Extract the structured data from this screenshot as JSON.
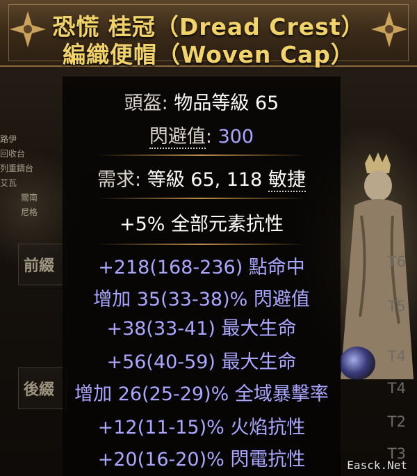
{
  "item": {
    "name": "恐慌 桂冠（Dread Crest）",
    "base_type": "編織便帽（Woven Cap）",
    "category": "頭盔",
    "item_level_label": "物品等級",
    "item_level": "65",
    "evasion_label": "閃避值",
    "evasion_value": "300",
    "requirement_label": "需求",
    "requirement_level_text": "等級 65, 118",
    "requirement_dex": "敏捷",
    "implicit": "+5% 全部元素抗性"
  },
  "mods": [
    {
      "text": "+218(168-236) 點命中",
      "tier": "T6"
    },
    {
      "text": "增加 35(33-38)% 閃避值",
      "tier": "T5"
    },
    {
      "text": "+38(33-41) 最大生命",
      "tier": ""
    },
    {
      "text": "+56(40-59) 最大生命",
      "tier": "T4"
    },
    {
      "text": "增加 26(25-29)% 全域暴擊率",
      "tier": "T4"
    },
    {
      "text": "+12(11-15)% 火焰抗性",
      "tier": "T2"
    },
    {
      "text": "+20(16-20)% 閃電抗性",
      "tier": "T3"
    }
  ],
  "side_panel": {
    "prefix_label": "前綴",
    "suffix_label": "後綴"
  },
  "map_labels": [
    "路伊",
    "回收台",
    "列重鑄台",
    "艾瓦",
    "爾南",
    "尼格"
  ],
  "watermark": "Easck.Net",
  "colors": {
    "title_gold": "#f2d36a",
    "magic_mod": "#a9a7ff",
    "property_grey": "#d8d4cd",
    "value_blue": "#a9a7ff",
    "tier_grey": "#6e6a66"
  }
}
